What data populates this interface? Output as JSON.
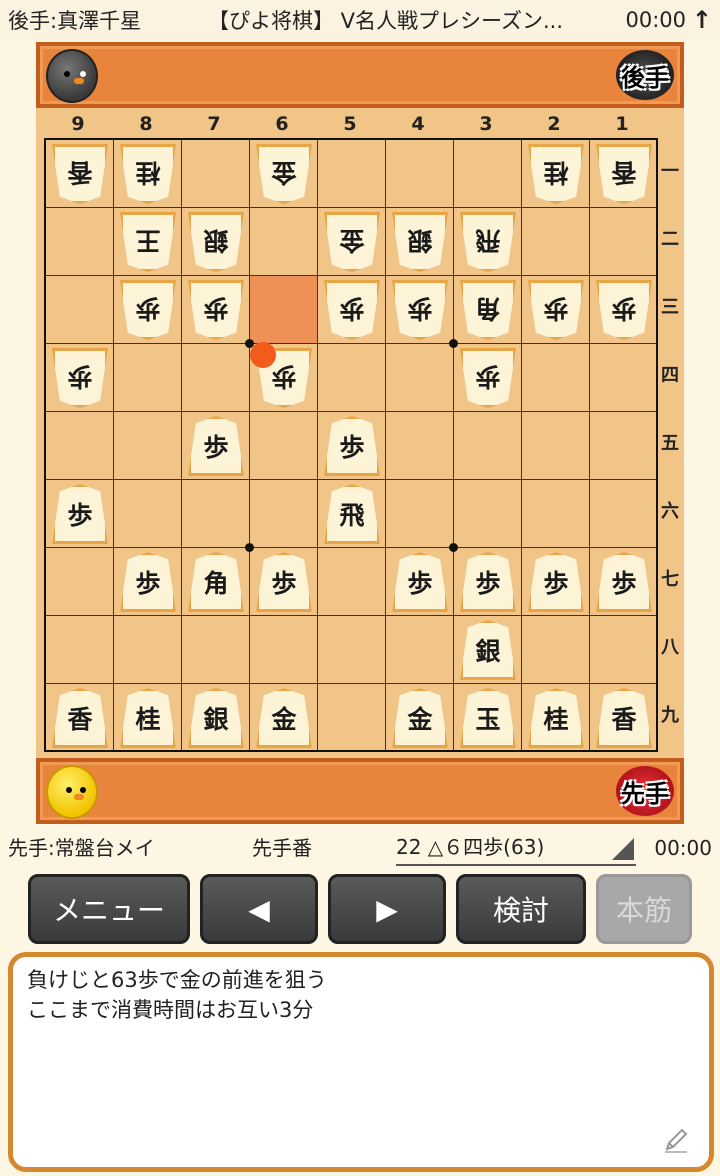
{
  "header": {
    "gote_player": "後手:真澤千星",
    "title": "【ぴよ将棋】 V名人戦プレシーズン...",
    "gote_time": "00:00",
    "scroll_up_icon": "arrow-up-icon"
  },
  "hands": {
    "gote_badge": "後手",
    "sente_badge": "先手"
  },
  "board": {
    "file_labels": [
      "9",
      "8",
      "7",
      "6",
      "5",
      "4",
      "3",
      "2",
      "1"
    ],
    "rank_labels": [
      "一",
      "二",
      "三",
      "四",
      "五",
      "六",
      "七",
      "八",
      "九"
    ],
    "last_move": {
      "file": 6,
      "rank": 4
    },
    "last_move_from": {
      "file": 6,
      "rank": 3
    },
    "pieces": [
      {
        "file": 9,
        "rank": 1,
        "char": "香",
        "owner": "gote"
      },
      {
        "file": 8,
        "rank": 1,
        "char": "桂",
        "owner": "gote"
      },
      {
        "file": 6,
        "rank": 1,
        "char": "金",
        "owner": "gote"
      },
      {
        "file": 2,
        "rank": 1,
        "char": "桂",
        "owner": "gote"
      },
      {
        "file": 1,
        "rank": 1,
        "char": "香",
        "owner": "gote"
      },
      {
        "file": 8,
        "rank": 2,
        "char": "王",
        "owner": "gote"
      },
      {
        "file": 7,
        "rank": 2,
        "char": "銀",
        "owner": "gote"
      },
      {
        "file": 5,
        "rank": 2,
        "char": "金",
        "owner": "gote"
      },
      {
        "file": 4,
        "rank": 2,
        "char": "銀",
        "owner": "gote"
      },
      {
        "file": 3,
        "rank": 2,
        "char": "飛",
        "owner": "gote"
      },
      {
        "file": 8,
        "rank": 3,
        "char": "歩",
        "owner": "gote"
      },
      {
        "file": 7,
        "rank": 3,
        "char": "歩",
        "owner": "gote"
      },
      {
        "file": 5,
        "rank": 3,
        "char": "歩",
        "owner": "gote"
      },
      {
        "file": 4,
        "rank": 3,
        "char": "歩",
        "owner": "gote"
      },
      {
        "file": 3,
        "rank": 3,
        "char": "角",
        "owner": "gote"
      },
      {
        "file": 2,
        "rank": 3,
        "char": "歩",
        "owner": "gote"
      },
      {
        "file": 1,
        "rank": 3,
        "char": "歩",
        "owner": "gote"
      },
      {
        "file": 9,
        "rank": 4,
        "char": "歩",
        "owner": "gote"
      },
      {
        "file": 6,
        "rank": 4,
        "char": "歩",
        "owner": "gote"
      },
      {
        "file": 3,
        "rank": 4,
        "char": "歩",
        "owner": "gote"
      },
      {
        "file": 7,
        "rank": 5,
        "char": "歩",
        "owner": "sente"
      },
      {
        "file": 5,
        "rank": 5,
        "char": "歩",
        "owner": "sente"
      },
      {
        "file": 9,
        "rank": 6,
        "char": "歩",
        "owner": "sente"
      },
      {
        "file": 5,
        "rank": 6,
        "char": "飛",
        "owner": "sente"
      },
      {
        "file": 8,
        "rank": 7,
        "char": "歩",
        "owner": "sente"
      },
      {
        "file": 7,
        "rank": 7,
        "char": "角",
        "owner": "sente"
      },
      {
        "file": 6,
        "rank": 7,
        "char": "歩",
        "owner": "sente"
      },
      {
        "file": 4,
        "rank": 7,
        "char": "歩",
        "owner": "sente"
      },
      {
        "file": 3,
        "rank": 7,
        "char": "歩",
        "owner": "sente"
      },
      {
        "file": 2,
        "rank": 7,
        "char": "歩",
        "owner": "sente"
      },
      {
        "file": 1,
        "rank": 7,
        "char": "歩",
        "owner": "sente"
      },
      {
        "file": 3,
        "rank": 8,
        "char": "銀",
        "owner": "sente"
      },
      {
        "file": 9,
        "rank": 9,
        "char": "香",
        "owner": "sente"
      },
      {
        "file": 8,
        "rank": 9,
        "char": "桂",
        "owner": "sente"
      },
      {
        "file": 7,
        "rank": 9,
        "char": "銀",
        "owner": "sente"
      },
      {
        "file": 6,
        "rank": 9,
        "char": "金",
        "owner": "sente"
      },
      {
        "file": 4,
        "rank": 9,
        "char": "金",
        "owner": "sente"
      },
      {
        "file": 3,
        "rank": 9,
        "char": "玉",
        "owner": "sente"
      },
      {
        "file": 2,
        "rank": 9,
        "char": "桂",
        "owner": "sente"
      },
      {
        "file": 1,
        "rank": 9,
        "char": "香",
        "owner": "sente"
      }
    ]
  },
  "info": {
    "sente_player": "先手:常盤台メイ",
    "turn": "先手番",
    "move": "22 △６四歩(63)",
    "sente_time": "00:00"
  },
  "buttons": {
    "menu": "メニュー",
    "prev": "◀",
    "next": "▶",
    "analyze": "検討",
    "mainline": "本筋"
  },
  "comment": {
    "lines": [
      "負けじと63歩で金の前進を狙う",
      "ここまで消費時間はお互い3分"
    ],
    "edit_icon": "pencil-icon"
  }
}
